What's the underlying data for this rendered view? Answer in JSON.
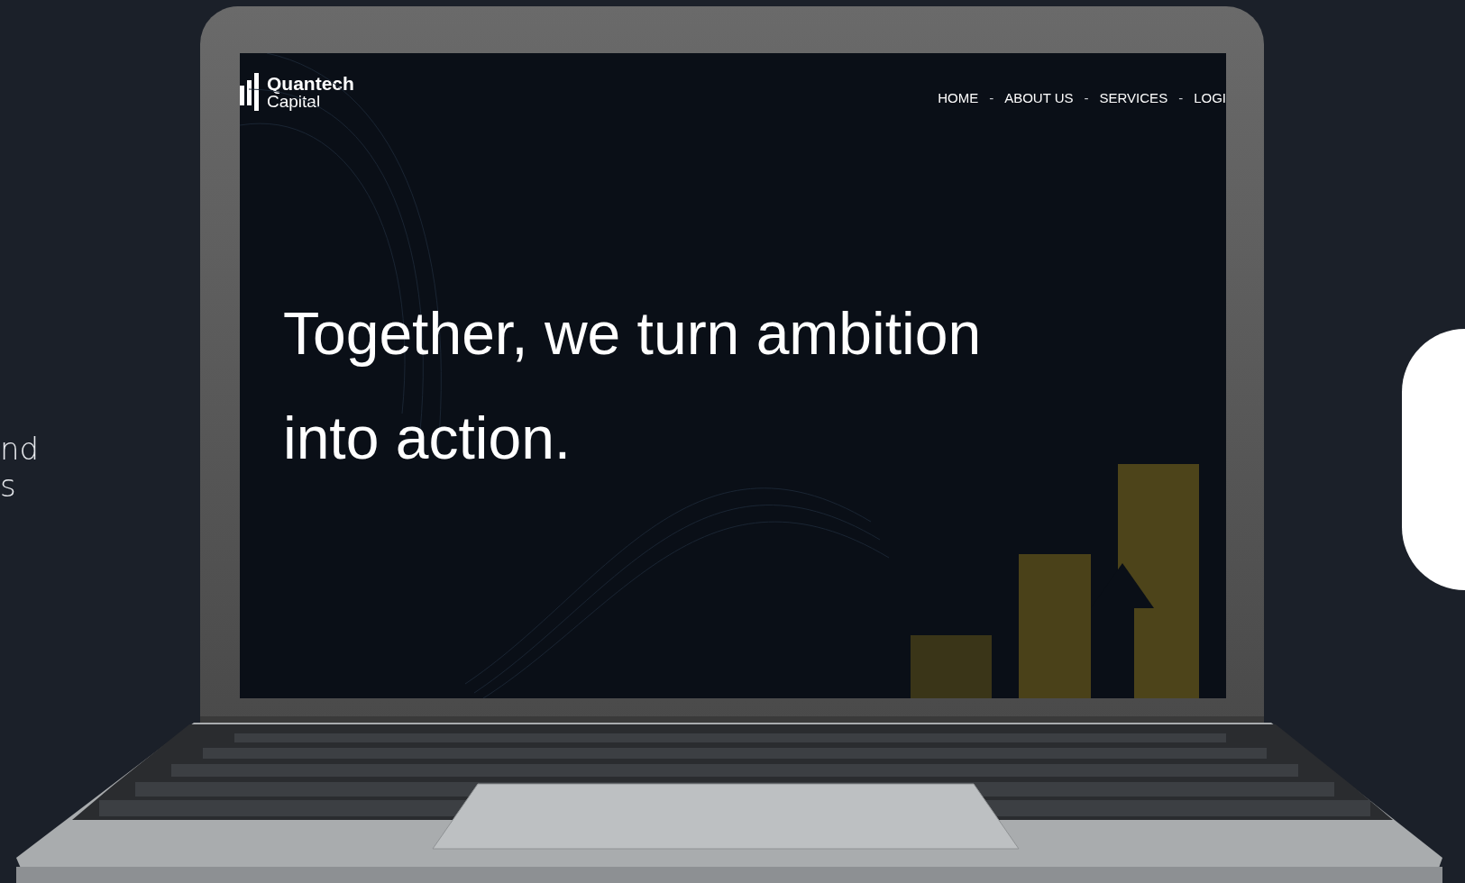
{
  "side_text": {
    "lines": [
      "nd",
      "s"
    ]
  },
  "site": {
    "logo": {
      "name": "Quantech",
      "subtitle": "Capital"
    },
    "nav": [
      {
        "kind": "link",
        "label": "HOME"
      },
      {
        "kind": "separator",
        "label": "-"
      },
      {
        "kind": "link",
        "label": "ABOUT US"
      },
      {
        "kind": "separator",
        "label": "-"
      },
      {
        "kind": "link",
        "label": "SERVICES"
      },
      {
        "kind": "separator",
        "label": "-"
      },
      {
        "kind": "link",
        "label": "LOGI"
      }
    ],
    "headline": "Together, we turn ambition into action."
  }
}
